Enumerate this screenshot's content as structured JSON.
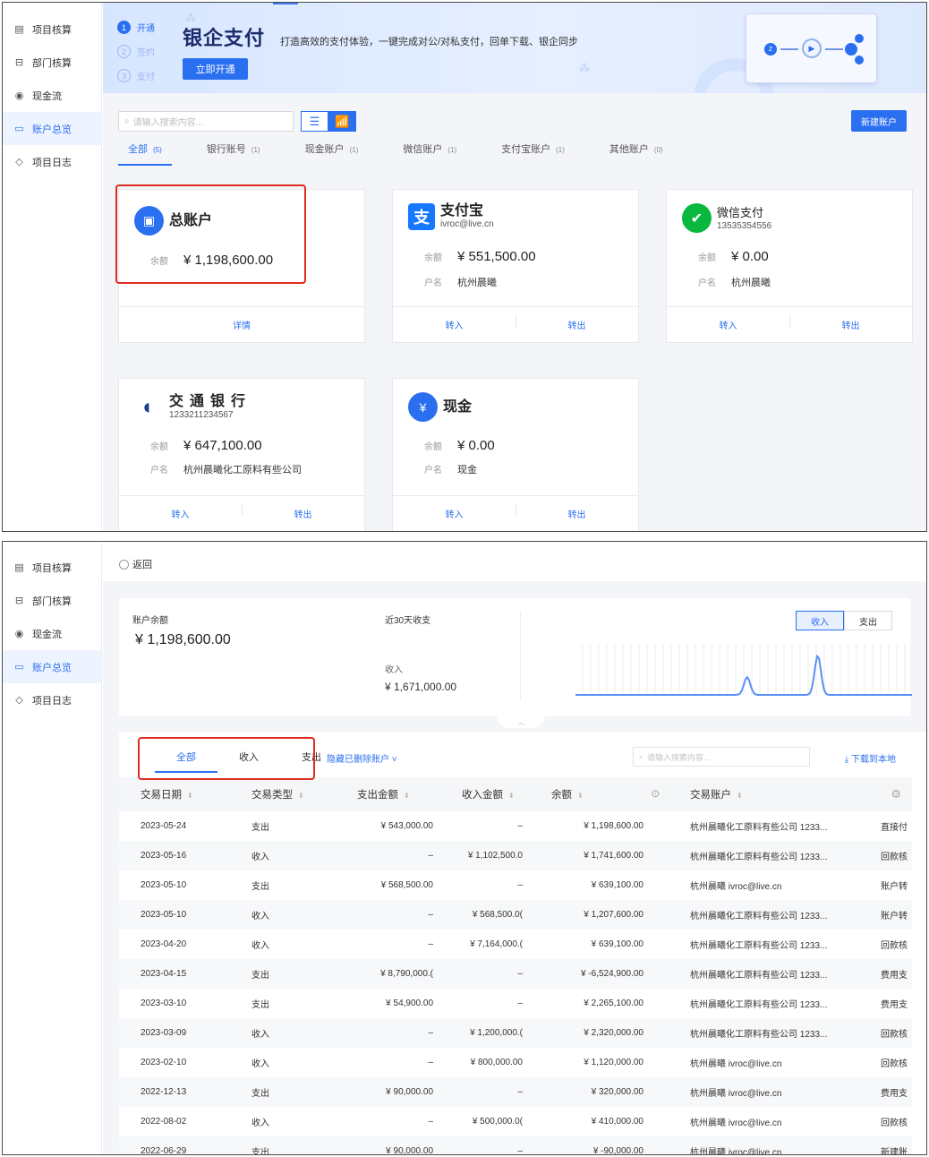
{
  "sidebar": {
    "items": [
      {
        "label": "项目核算",
        "icon": "ledger-icon",
        "glyph": "▤",
        "active": false
      },
      {
        "label": "部门核算",
        "icon": "department-icon",
        "glyph": "⊟",
        "active": false
      },
      {
        "label": "现金流",
        "icon": "cashflow-icon",
        "glyph": "◉",
        "active": false
      },
      {
        "label": "账户总览",
        "icon": "account-icon",
        "glyph": "▭",
        "active": true
      },
      {
        "label": "项目日志",
        "icon": "tag-icon",
        "glyph": "◇",
        "active": false
      }
    ]
  },
  "banner": {
    "steps": [
      {
        "num": "1",
        "label": "开通",
        "active": true
      },
      {
        "num": "2",
        "label": "签约",
        "active": false
      },
      {
        "num": "3",
        "label": "支付",
        "active": false
      }
    ],
    "title": "银企支付",
    "description": "打造高效的支付体验，一键完成对公/对私支付，回单下载、银企同步",
    "open_button": "立即开通"
  },
  "toolbar": {
    "search_placeholder": "请输入搜索内容...",
    "new_account_button": "新建账户"
  },
  "account_tabs": [
    {
      "label": "全部",
      "count": "(5)",
      "active": true
    },
    {
      "label": "银行账号",
      "count": "(1)",
      "active": false
    },
    {
      "label": "现金账户",
      "count": "(1)",
      "active": false
    },
    {
      "label": "微信账户",
      "count": "(1)",
      "active": false
    },
    {
      "label": "支付宝账户",
      "count": "(1)",
      "active": false
    },
    {
      "label": "其他账户",
      "count": "(0)",
      "active": false
    }
  ],
  "cards": {
    "total": {
      "name": "总账户",
      "balance_label": "余额",
      "balance": "¥ 1,198,600.00",
      "detail": "详情",
      "color": "#2a6ff0"
    },
    "alipay": {
      "name": "支付宝",
      "sub": "ivroc@live.cn",
      "balance_label": "余额",
      "balance": "¥ 551,500.00",
      "holder_label": "户名",
      "holder": "杭州晨曦",
      "in": "转入",
      "out": "转出",
      "color": "#1677ff"
    },
    "wechat": {
      "name": "微信支付",
      "sub": "13535354556",
      "balance_label": "余额",
      "balance": "¥ 0.00",
      "holder_label": "户名",
      "holder": "杭州晨曦",
      "in": "转入",
      "out": "转出",
      "color": "#09b83e"
    },
    "bank": {
      "name": "交通银行",
      "sub": "1233211234567",
      "balance_label": "余额",
      "balance": "¥ 647,100.00",
      "holder_label": "户名",
      "holder": "杭州晨曦化工原料有些公司",
      "in": "转入",
      "out": "转出",
      "color": "#1d3f8f"
    },
    "cash": {
      "name": "现金",
      "balance_label": "余额",
      "balance": "¥ 0.00",
      "holder_label": "户名",
      "holder": "现金",
      "in": "转入",
      "out": "转出",
      "color": "#2a6ff0"
    }
  },
  "detail": {
    "back": "返回",
    "balance_label": "账户余额",
    "balance": "¥ 1,198,600.00",
    "recent_label": "近30天收支",
    "income_label": "收入",
    "income_value": "¥ 1,671,000.00",
    "segments": [
      {
        "label": "收入",
        "active": true
      },
      {
        "label": "支出",
        "active": false
      }
    ],
    "sparkline": {
      "peaks": [
        {
          "position": 0.51,
          "height": 0.45
        },
        {
          "position": 0.72,
          "height": 1.0
        }
      ],
      "color": "#5b8ff5"
    },
    "tabs": [
      {
        "label": "全部",
        "active": true
      },
      {
        "label": "收入",
        "active": false
      },
      {
        "label": "支出",
        "active": false
      }
    ],
    "hide_deleted": "隐藏已删除账户",
    "search_placeholder": "请输入搜索内容...",
    "download": "下载到本地",
    "columns": [
      "交易日期",
      "交易类型",
      "支出金额",
      "收入金额",
      "余额",
      "交易账户"
    ],
    "rows": [
      {
        "date": "2023-05-24",
        "type": "支出",
        "out": "¥ 543,000.00",
        "in": "–",
        "balance": "¥ 1,198,600.00",
        "account": "杭州晨曦化工原料有些公司 1233...",
        "remark": "直接付"
      },
      {
        "date": "2023-05-16",
        "type": "收入",
        "out": "–",
        "in": "¥ 1,102,500.0",
        "balance": "¥ 1,741,600.00",
        "account": "杭州晨曦化工原料有些公司 1233...",
        "remark": "回款核"
      },
      {
        "date": "2023-05-10",
        "type": "支出",
        "out": "¥ 568,500.00",
        "in": "–",
        "balance": "¥ 639,100.00",
        "account": "杭州晨曦 ivroc@live.cn",
        "remark": "账户转"
      },
      {
        "date": "2023-05-10",
        "type": "收入",
        "out": "–",
        "in": "¥ 568,500.0(",
        "balance": "¥ 1,207,600.00",
        "account": "杭州晨曦化工原料有些公司 1233...",
        "remark": "账户转"
      },
      {
        "date": "2023-04-20",
        "type": "收入",
        "out": "–",
        "in": "¥ 7,164,000.(",
        "balance": "¥ 639,100.00",
        "account": "杭州晨曦化工原料有些公司 1233...",
        "remark": "回款核"
      },
      {
        "date": "2023-04-15",
        "type": "支出",
        "out": "¥ 8,790,000.(",
        "in": "–",
        "balance": "¥ -6,524,900.00",
        "account": "杭州晨曦化工原料有些公司 1233...",
        "remark": "费用支"
      },
      {
        "date": "2023-03-10",
        "type": "支出",
        "out": "¥ 54,900.00",
        "in": "–",
        "balance": "¥ 2,265,100.00",
        "account": "杭州晨曦化工原料有些公司 1233...",
        "remark": "费用支"
      },
      {
        "date": "2023-03-09",
        "type": "收入",
        "out": "–",
        "in": "¥ 1,200,000.(",
        "balance": "¥ 2,320,000.00",
        "account": "杭州晨曦化工原料有些公司 1233...",
        "remark": "回款核"
      },
      {
        "date": "2023-02-10",
        "type": "收入",
        "out": "–",
        "in": "¥ 800,000.00",
        "balance": "¥ 1,120,000.00",
        "account": "杭州晨曦 ivroc@live.cn",
        "remark": "回款核"
      },
      {
        "date": "2022-12-13",
        "type": "支出",
        "out": "¥ 90,000.00",
        "in": "–",
        "balance": "¥ 320,000.00",
        "account": "杭州晨曦 ivroc@live.cn",
        "remark": "费用支"
      },
      {
        "date": "2022-08-02",
        "type": "收入",
        "out": "–",
        "in": "¥ 500,000.0(",
        "balance": "¥ 410,000.00",
        "account": "杭州晨曦 ivroc@live.cn",
        "remark": "回款核"
      },
      {
        "date": "2022-06-29",
        "type": "支出",
        "out": "¥ 90,000.00",
        "in": "–",
        "balance": "¥ -90,000.00",
        "account": "杭州晨曦 ivroc@live.cn",
        "remark": "新建账"
      }
    ]
  },
  "colors": {
    "accent": "#2a6ff0",
    "highlight": "#e02b20"
  }
}
